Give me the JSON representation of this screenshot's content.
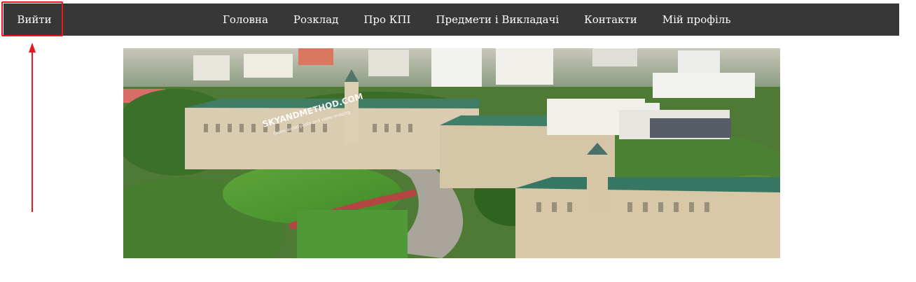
{
  "nav": {
    "logout_label": "Вийти",
    "items": [
      {
        "label": "Головна"
      },
      {
        "label": "Розклад"
      },
      {
        "label": "Про КПІ"
      },
      {
        "label": "Предмети і Викладачі"
      },
      {
        "label": "Контакти"
      },
      {
        "label": "Мій профіль"
      }
    ]
  },
  "hero": {
    "watermark_title": "SKYANDMETHOD.COM",
    "watermark_subtitle": "Drone aerial photo and video imaging"
  },
  "colors": {
    "navbar_bg": "#373737",
    "nav_text": "#ffffff",
    "annotation_red": "#e8161f"
  },
  "icons": {
    "annotation_arrow": "up-arrow-icon"
  }
}
